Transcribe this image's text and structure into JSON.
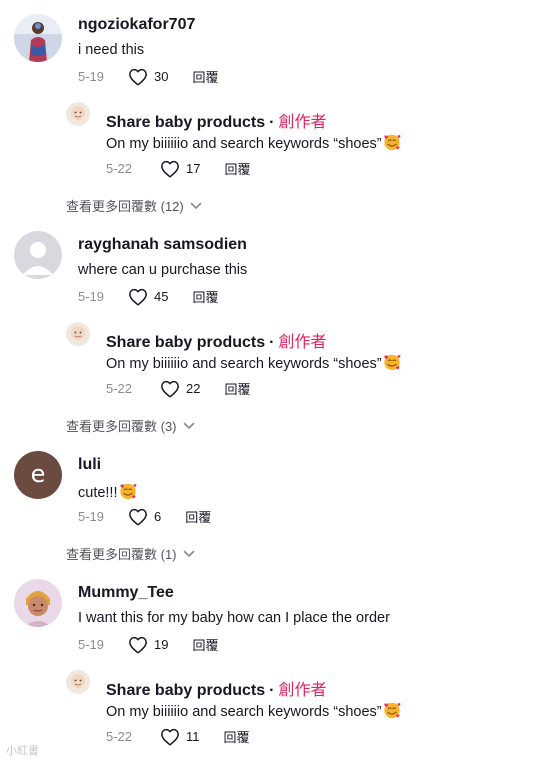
{
  "comments": [
    {
      "user": "ngoziokafor707",
      "text": "i need this",
      "date": "5-19",
      "likes": "30",
      "reply_label": "回覆",
      "reply": {
        "user": "Share baby products",
        "creator_label": "創作者",
        "text": "On my biiiiiio and search keywords “shoes”",
        "date": "5-22",
        "likes": "17",
        "reply_label": "回覆"
      },
      "more_label": "查看更多回覆數 (12)"
    },
    {
      "user": "rayghanah samsodien",
      "text": "where can u purchase this",
      "date": "5-19",
      "likes": "45",
      "reply_label": "回覆",
      "reply": {
        "user": "Share baby products",
        "creator_label": "創作者",
        "text": "On my biiiiiio and search keywords “shoes”",
        "date": "5-22",
        "likes": "22",
        "reply_label": "回覆"
      },
      "more_label": "查看更多回覆數 (3)"
    },
    {
      "user": "luli",
      "avatar_letter": "e",
      "text": "cute!!!",
      "date": "5-19",
      "likes": "6",
      "reply_label": "回覆",
      "more_label": "查看更多回覆數 (1)"
    },
    {
      "user": "Mummy_Tee",
      "text": "I want this for my baby how can I place the order",
      "date": "5-19",
      "likes": "19",
      "reply_label": "回覆",
      "reply": {
        "user": "Share baby products",
        "creator_label": "創作者",
        "text": "On my biiiiiio and search keywords “shoes”",
        "date": "5-22",
        "likes": "11",
        "reply_label": "回覆"
      }
    }
  ],
  "icons": {
    "heart": "heart-outline-icon",
    "chevron": "chevron-down-icon",
    "emoji": "smiling-face-with-hearts-emoji"
  },
  "colors": {
    "creator": "#e0245e",
    "muted": "#8a8b91",
    "text": "#161823"
  },
  "watermark": "小紅書"
}
